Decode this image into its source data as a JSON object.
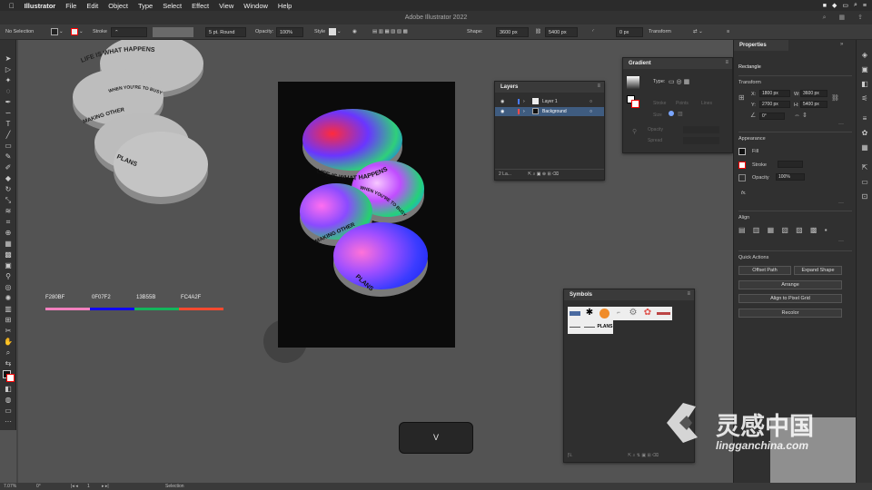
{
  "menubar": {
    "apple": "",
    "app": "Illustrator",
    "items": [
      "File",
      "Edit",
      "Object",
      "Type",
      "Select",
      "Effect",
      "View",
      "Window",
      "Help"
    ]
  },
  "window": {
    "title": "Adobe Illustrator 2022"
  },
  "control": {
    "selection": "No Selection",
    "stroke_label": "Stroke",
    "brush": "5 pt. Round",
    "opacity_label": "Opacity:",
    "opacity_value": "100%",
    "style_label": "Style",
    "shape_label": "Shape:",
    "shape_w": "3600 px",
    "shape_h": "5400 px",
    "corner": "0 px",
    "transform_label": "Transform"
  },
  "canvas": {
    "left_phrases": [
      "LIFE IS WHAT HAPPENS",
      "WHEN YOU'RE TO BUSY",
      "MAKING OTHER",
      "PLANS"
    ],
    "art_phrases": [
      "LIFE IS WHAT HAPPENS",
      "WHEN YOU'RE TO BUSY",
      "MAKING OTHER",
      "PLANS"
    ],
    "swatches": [
      {
        "label": "F280BF",
        "color": "#F280BF"
      },
      {
        "label": "0F07F2",
        "color": "#0F07F2"
      },
      {
        "label": "13B55B",
        "color": "#13B55B"
      },
      {
        "label": "FC4A2F",
        "color": "#FC4A2F"
      }
    ]
  },
  "layers": {
    "title": "Layers",
    "rows": [
      {
        "name": "Layer 1",
        "color": "#4a7bff"
      },
      {
        "name": "Background",
        "color": "#ff4a4a"
      }
    ],
    "footer": "2 La..."
  },
  "gradient": {
    "title": "Gradient",
    "type_label": "Type:",
    "stroke_label": "Stroke",
    "stroke_opts": [
      "Points",
      "Lines"
    ],
    "size_label": "Size",
    "opacity_label": "Opacity",
    "spread_label": "Spread"
  },
  "symbols": {
    "title": "Symbols",
    "plans": "PLANS",
    "footer": "|\\\\."
  },
  "properties": {
    "title": "Properties",
    "object": "Rectangle",
    "transform_label": "Transform",
    "x_label": "X:",
    "x": "1800 px",
    "y_label": "Y:",
    "y": "2700 px",
    "w_label": "W:",
    "w": "3600 px",
    "h_label": "H:",
    "h": "5400 px",
    "angle": "0°",
    "appearance_label": "Appearance",
    "fill_label": "Fill",
    "stroke_label": "Stroke",
    "opacity_label": "Opacity",
    "opacity": "100%",
    "fx": "fx.",
    "align_label": "Align",
    "quick_actions_label": "Quick Actions",
    "btn_offset_path": "Offset Path",
    "btn_expand_shape": "Expand Shape",
    "btn_arrange": "Arrange",
    "btn_align_pixel": "Align to Pixel Grid",
    "btn_recolor": "Recolor"
  },
  "status": {
    "zoom": "7.07%",
    "rotate": "0°",
    "page": "1",
    "tool": "Selection"
  },
  "overlay": {
    "key": "V"
  },
  "watermark": {
    "cn": "灵感中国",
    "url": "lingganchina.com"
  }
}
